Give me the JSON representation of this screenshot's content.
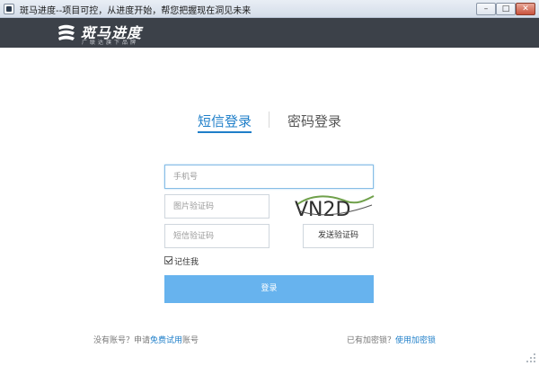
{
  "window": {
    "title": "斑马进度--项目可控，从进度开始，帮您把握现在洞见未来",
    "minimize_glyph": "–",
    "maximize_glyph": "□",
    "close_glyph": "✕"
  },
  "brand": {
    "name": "斑马进度",
    "slogan": "广联达旗下品牌"
  },
  "tabs": [
    {
      "label": "短信登录",
      "active": true
    },
    {
      "label": "密码登录",
      "active": false
    }
  ],
  "form": {
    "phone_placeholder": "手机号",
    "phone_value": "",
    "captcha_placeholder": "图片验证码",
    "captcha_image_text": "VN2D",
    "sms_placeholder": "短信验证码",
    "send_code_label": "发送验证码",
    "remember_label": "记住我",
    "remember_checked": true,
    "login_label": "登录"
  },
  "footer": {
    "left_prefix": "没有账号？申请",
    "left_link": "免费试用",
    "left_suffix": "账号",
    "right_prefix": "已有加密锁？",
    "right_link": "使用加密锁"
  },
  "colors": {
    "accent": "#1f7fc9",
    "login_button": "#67b3ee",
    "brand_bar": "#3c4149"
  }
}
